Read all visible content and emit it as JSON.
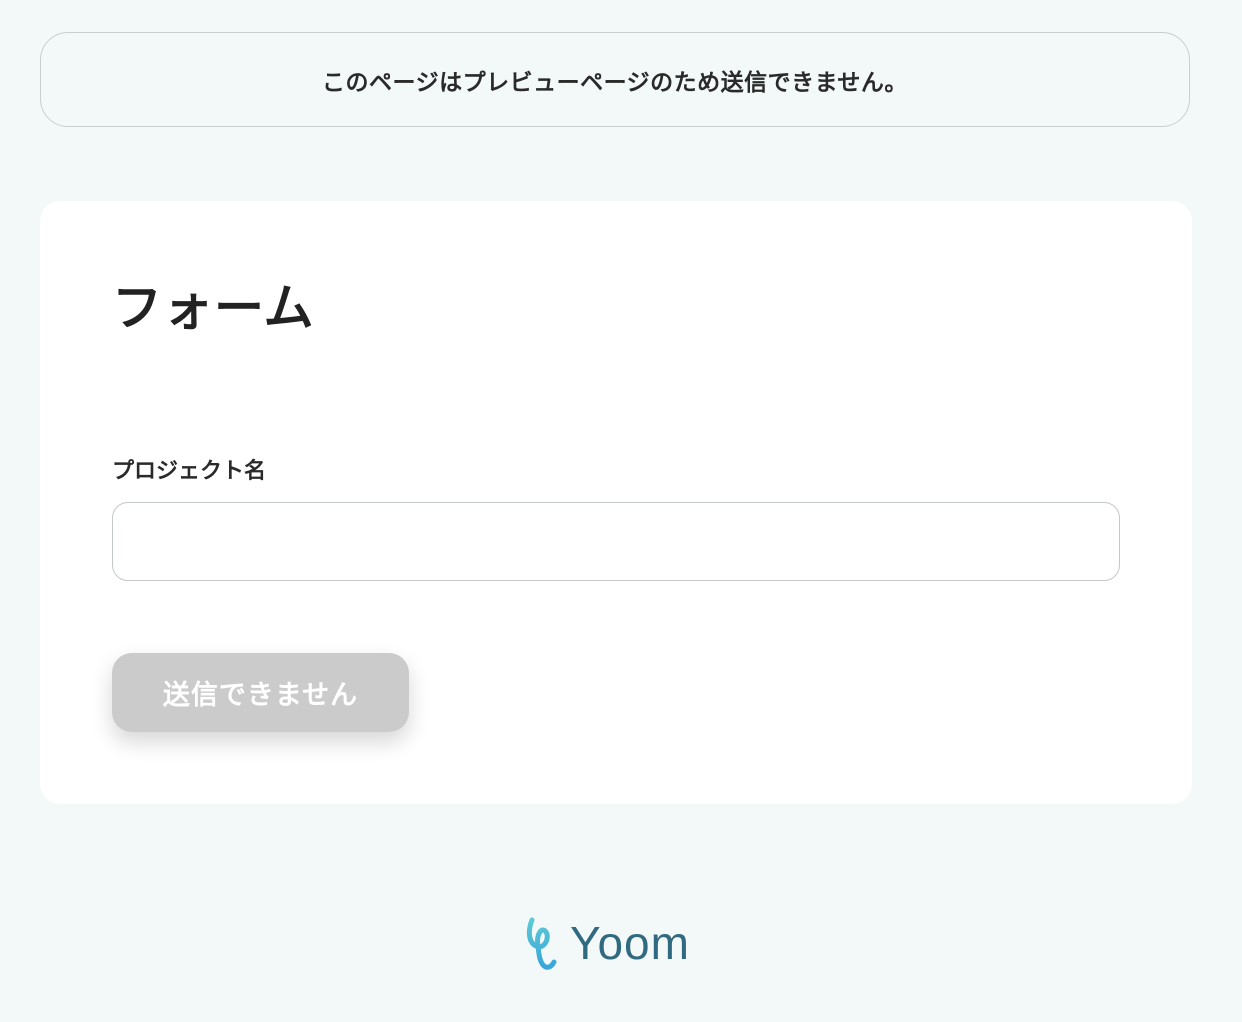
{
  "notice": {
    "text": "このページはプレビューページのため送信できません。"
  },
  "form": {
    "title": "フォーム",
    "fields": [
      {
        "label": "プロジェクト名",
        "value": "",
        "placeholder": ""
      }
    ],
    "submit_label": "送信できません"
  },
  "footer": {
    "logo_text": "Yoom",
    "logo_icon": "yoom-logo-icon"
  },
  "colors": {
    "background": "#f3f8f8",
    "card": "#ffffff",
    "button_disabled": "#cbcbcb",
    "logo_text": "#2f6a80",
    "logo_mark": "#4fc3d4"
  }
}
